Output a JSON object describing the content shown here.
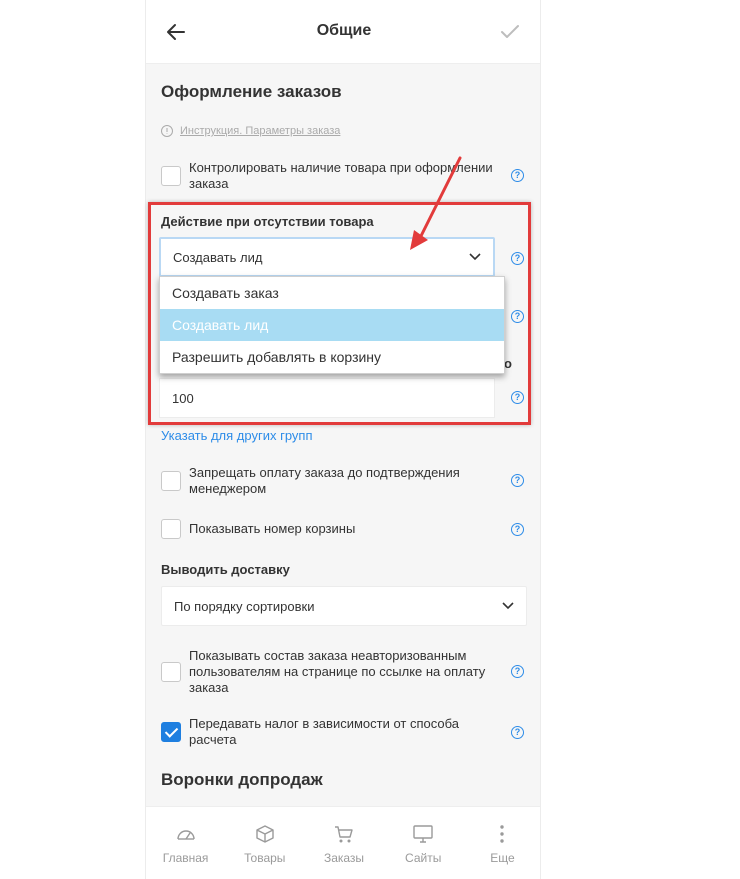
{
  "header": {
    "title": "Общие"
  },
  "section_orders": {
    "title": "Оформление заказов",
    "instruction_link": "Инструкция. Параметры заказа"
  },
  "check_stock": {
    "label": "Контролировать наличие товара при оформлении заказа",
    "checked": false
  },
  "no_stock_action": {
    "label": "Действие при отсутствии товара",
    "selected": "Создавать лид",
    "options": [
      "Создавать заказ",
      "Создавать лид",
      "Разрешить добавлять в корзину"
    ]
  },
  "partial_label_tail": "о",
  "quantity_field": {
    "value": "100"
  },
  "other_groups_link": "Указать для других групп",
  "forbid_payment": {
    "label": "Запрещать оплату заказа до подтверждения менеджером",
    "checked": false
  },
  "show_cart_number": {
    "label": "Показывать номер корзины",
    "checked": false
  },
  "delivery": {
    "label": "Выводить доставку",
    "selected": "По порядку сортировки"
  },
  "show_order_contents": {
    "label": "Показывать состав заказа неавторизованным пользователям на странице по ссылке на оплату заказа",
    "checked": false
  },
  "pass_tax": {
    "label": "Передавать налог в зависимости от способа расчета",
    "checked": true
  },
  "section_funnels": {
    "title": "Воронки допродаж"
  },
  "bottom_nav": [
    {
      "label": "Главная",
      "icon": "dashboard-icon"
    },
    {
      "label": "Товары",
      "icon": "box-icon"
    },
    {
      "label": "Заказы",
      "icon": "cart-icon"
    },
    {
      "label": "Сайты",
      "icon": "monitor-icon"
    },
    {
      "label": "Еще",
      "icon": "more-icon"
    }
  ],
  "colors": {
    "accent": "#2d8ce8",
    "highlight": "#e23b3b",
    "selected_option": "#a8dcf3"
  }
}
